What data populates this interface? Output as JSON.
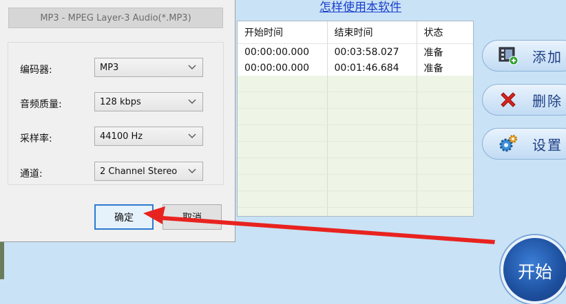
{
  "help_link": "怎样使用本软件",
  "dialog": {
    "format": "MP3 - MPEG Layer-3 Audio(*.MP3)",
    "fields": [
      {
        "label": "编码器:",
        "value": "MP3"
      },
      {
        "label": "音频质量:",
        "value": "128 kbps"
      },
      {
        "label": "采样率:",
        "value": "44100 Hz"
      },
      {
        "label": "通道:",
        "value": "2 Channel Stereo"
      }
    ],
    "ok_label": "确定",
    "cancel_label": "取消"
  },
  "table": {
    "headers": [
      "开始时间",
      "结束时间",
      "状态"
    ],
    "rows": [
      [
        "00:00:00.000",
        "00:03:58.027",
        "准备"
      ],
      [
        "00:00:00.000",
        "00:01:46.684",
        "准备"
      ]
    ]
  },
  "side_buttons": {
    "add_label": "添加",
    "delete_label": "删除",
    "settings_label": "设置"
  },
  "start_label": "开始",
  "colors": {
    "arrow": "#e8231f",
    "link": "#1a3fcc",
    "ok_border": "#2b79d0",
    "background": "#c9e2f5"
  },
  "icons": [
    "film-add-icon",
    "delete-x-icon",
    "gear-settings-icon",
    "chevron-down-icon"
  ]
}
